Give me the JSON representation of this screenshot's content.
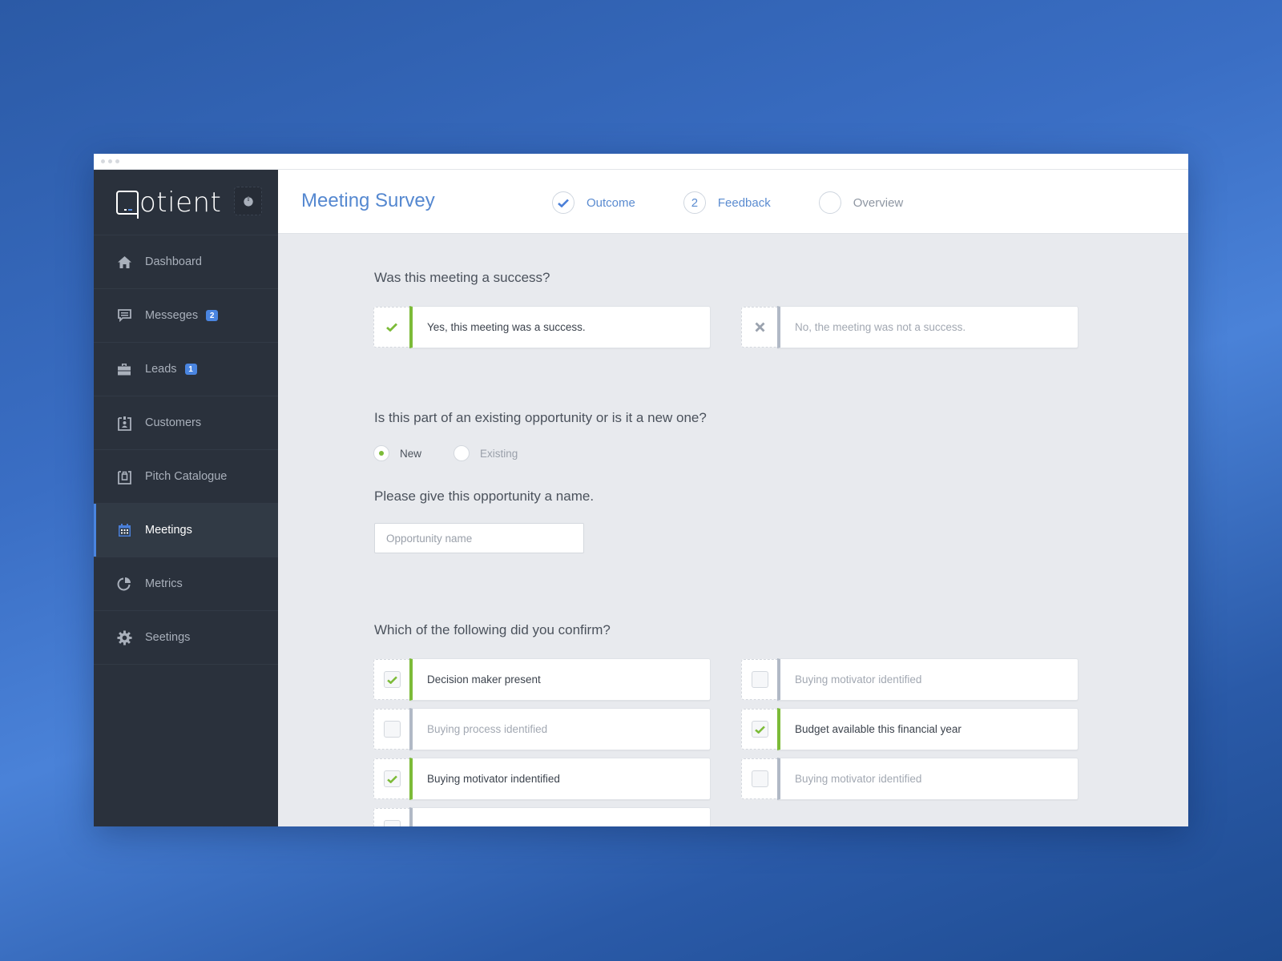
{
  "app": {
    "brand": "otient",
    "window_dots": 3
  },
  "sidebar": {
    "power_button_label": "Power",
    "items": [
      {
        "label": "Dashboard",
        "icon": "home-icon",
        "badge": null,
        "active": false
      },
      {
        "label": "Messeges",
        "icon": "message-icon",
        "badge": "2",
        "active": false
      },
      {
        "label": "Leads",
        "icon": "briefcase-icon",
        "badge": "1",
        "active": false
      },
      {
        "label": "Customers",
        "icon": "id-badge-icon",
        "badge": null,
        "active": false
      },
      {
        "label": "Pitch Catalogue",
        "icon": "catalogue-icon",
        "badge": null,
        "active": false
      },
      {
        "label": "Meetings",
        "icon": "calendar-icon",
        "badge": null,
        "active": true
      },
      {
        "label": "Metrics",
        "icon": "pie-chart-icon",
        "badge": null,
        "active": false
      },
      {
        "label": "Seetings",
        "icon": "gear-icon",
        "badge": null,
        "active": false
      }
    ]
  },
  "header": {
    "title": "Meeting Survey",
    "steps": [
      {
        "label": "Outcome",
        "marker": "check",
        "state": "done"
      },
      {
        "label": "Feedback",
        "marker": "2",
        "state": "current"
      },
      {
        "label": "Overview",
        "marker": "",
        "state": "pending"
      }
    ]
  },
  "survey": {
    "q1": {
      "question": "Was this meeting a success?",
      "options": [
        {
          "label": "Yes, this meeting was a success.",
          "icon": "check-icon",
          "selected": true
        },
        {
          "label": "No, the meeting was not a success.",
          "icon": "x-icon",
          "selected": false
        }
      ]
    },
    "q2": {
      "question": "Is this part of an existing opportunity or is it a new one?",
      "options": [
        {
          "label": "New",
          "selected": true
        },
        {
          "label": "Existing",
          "selected": false
        }
      ]
    },
    "q3": {
      "question": "Please give this opportunity a name.",
      "input_value": "",
      "input_placeholder": "Opportunity name"
    },
    "q4": {
      "question": "Which of the following did you confirm?",
      "options": [
        {
          "label": "Decision maker present",
          "checked": true
        },
        {
          "label": "Buying motivator identified",
          "checked": false
        },
        {
          "label": "Buying process identified",
          "checked": false
        },
        {
          "label": "Budget available this financial year",
          "checked": true
        },
        {
          "label": "Buying motivator indentified",
          "checked": true
        },
        {
          "label": "Buying motivator identified",
          "checked": false
        },
        {
          "label": "",
          "checked": false
        }
      ]
    }
  },
  "colors": {
    "accent_blue": "#4a85e0",
    "success_green": "#7cbb38",
    "sidebar_bg": "#2a313c",
    "title_blue": "#5588d0"
  }
}
